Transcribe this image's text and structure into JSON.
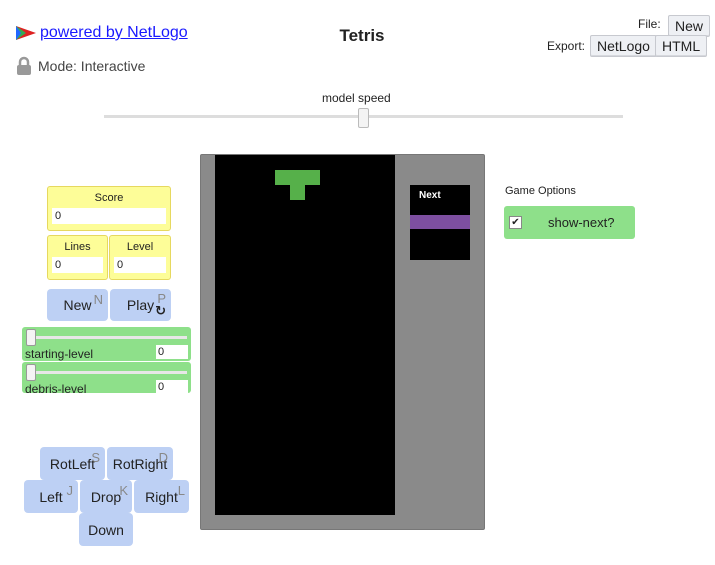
{
  "header": {
    "powered_by": "powered by NetLogo",
    "title": "Tetris",
    "mode": "Mode: Interactive",
    "file_label": "File:",
    "new_label": "New",
    "export_label": "Export:",
    "export_netlogo": "NetLogo",
    "export_html": "HTML"
  },
  "speed": {
    "label": "model speed",
    "value": 0.5
  },
  "monitors": {
    "score_label": "Score",
    "score_value": "0",
    "lines_label": "Lines",
    "lines_value": "0",
    "level_label": "Level",
    "level_value": "0"
  },
  "buttons": {
    "new": "New",
    "new_key": "N",
    "play": "Play",
    "play_key": "P",
    "rotleft": "RotLeft",
    "rotleft_key": "S",
    "rotright": "RotRight",
    "rotright_key": "D",
    "left": "Left",
    "left_key": "J",
    "drop": "Drop",
    "drop_key": "K",
    "right": "Right",
    "right_key": "L",
    "down": "Down"
  },
  "sliders": {
    "starting_level_label": "starting-level",
    "starting_level_value": "0",
    "debris_level_label": "debris-level",
    "debris_level_value": "0"
  },
  "world": {
    "next_label": "Next"
  },
  "options": {
    "title": "Game Options",
    "show_next_label": "show-next?",
    "show_next_checked": true
  },
  "colors": {
    "button": "#bdd0f4",
    "monitor": "#fdfd98",
    "slider": "#8ee08a",
    "piece_active": "#56b04a",
    "piece_next": "#7d4fa0"
  }
}
